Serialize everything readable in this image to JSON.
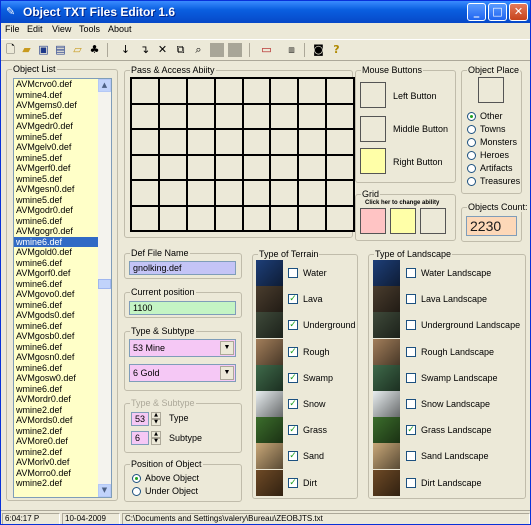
{
  "window": {
    "title": "Object TXT Files Editor 1.6"
  },
  "menu": [
    "File",
    "Edit",
    "View",
    "Tools",
    "About"
  ],
  "toolbar": {
    "icons": [
      "new-file-icon",
      "open-folder-icon",
      "save-icon",
      "save-all-icon",
      "open-file-icon",
      "tree-icon",
      "move-down-icon",
      "move-down-2-icon",
      "delete-icon",
      "copy-icon",
      "find-icon",
      "blank-1-icon",
      "blank-2-icon",
      "monitor-icon",
      "text-file-icon",
      "camera-icon",
      "help-icon"
    ]
  },
  "object_list": {
    "label": "Object List",
    "items": [
      "AVMcrvo0.def",
      "wmine4.def",
      "AVMgems0.def",
      "wmine5.def",
      "AVMgedr0.def",
      "wmine5.def",
      "AVMgelv0.def",
      "wmine5.def",
      "AVMgerf0.def",
      "wmine5.def",
      "AVMgesn0.def",
      "wmine5.def",
      "AVMgodr0.def",
      "wmine6.def",
      "AVMgogr0.def",
      "wmine6.def",
      "AVMgold0.def",
      "wmine6.def",
      "AVMgorf0.def",
      "wmine6.def",
      "AVMgovo0.def",
      "wmine6.def",
      "AVMgods0.def",
      "wmine6.def",
      "AVMgosb0.def",
      "wmine6.def",
      "AVMgosn0.def",
      "wmine6.def",
      "AVMgosw0.def",
      "wmine6.def",
      "AVMordr0.def",
      "wmine2.def",
      "AVMords0.def",
      "wmine2.def",
      "AVMore0.def",
      "wmine2.def",
      "AVMorlv0.def",
      "AVMorro0.def",
      "wmine2.def"
    ],
    "selected_index": 15
  },
  "pass_access": {
    "label": "Pass & Access Abiity",
    "rows": 6,
    "cols": 8
  },
  "mouse_buttons": {
    "label": "Mouse Buttons",
    "left": "Left Button",
    "middle": "Middle Button",
    "right": "Right Button"
  },
  "object_place": {
    "label": "Object Place",
    "options": [
      "Other",
      "Towns",
      "Monsters",
      "Heroes",
      "Artifacts",
      "Treasures"
    ],
    "selected": "Other"
  },
  "grid_group": {
    "label": "Grid",
    "hint": "Click her to change ability"
  },
  "objects_count": {
    "label": "Objects Count:",
    "value": "2230"
  },
  "def_file": {
    "label": "Def File Name",
    "value": "gnolking.def"
  },
  "current_position": {
    "label": "Current position",
    "value": "1100"
  },
  "type_subtype": {
    "label": "Type & Subtype",
    "type_value": "53  Mine",
    "subtype_value": "6  Gold"
  },
  "type_subtype2": {
    "label": "Type & Subtype",
    "type_num": "53",
    "type_label": "Type",
    "subtype_num": "6",
    "subtype_label": "Subtype"
  },
  "position_of_object": {
    "label": "Position of Object",
    "options": [
      "Above Object",
      "Under Object"
    ],
    "selected": "Above Object"
  },
  "terrain": {
    "label": "Type of Terrain",
    "items": [
      {
        "name": "Water",
        "checked": false,
        "color": "#1e3f78"
      },
      {
        "name": "Lava",
        "checked": true,
        "color": "#4a3d2e"
      },
      {
        "name": "Underground",
        "checked": true,
        "color": "#3f4a3a"
      },
      {
        "name": "Rough",
        "checked": true,
        "color": "#a27e5a"
      },
      {
        "name": "Swamp",
        "checked": true,
        "color": "#3f6a4a"
      },
      {
        "name": "Snow",
        "checked": true,
        "color": "#e8eef0"
      },
      {
        "name": "Grass",
        "checked": true,
        "color": "#3c6e2c"
      },
      {
        "name": "Sand",
        "checked": true,
        "color": "#c9a878"
      },
      {
        "name": "Dirt",
        "checked": true,
        "color": "#6e4a26"
      }
    ]
  },
  "landscape": {
    "label": "Type of Landscape",
    "items": [
      {
        "name": "Water Landscape",
        "checked": false,
        "color": "#1e3f78"
      },
      {
        "name": "Lava Landscape",
        "checked": false,
        "color": "#4a3d2e"
      },
      {
        "name": "Underground Landscape",
        "checked": false,
        "color": "#3f4a3a"
      },
      {
        "name": "Rough Landscape",
        "checked": false,
        "color": "#a27e5a"
      },
      {
        "name": "Swamp Landscape",
        "checked": false,
        "color": "#3f6a4a"
      },
      {
        "name": "Snow Landscape",
        "checked": false,
        "color": "#e8eef0"
      },
      {
        "name": "Grass Landscape",
        "checked": true,
        "color": "#3c6e2c"
      },
      {
        "name": "Sand Landscape",
        "checked": false,
        "color": "#c9a878"
      },
      {
        "name": "Dirt Landscape",
        "checked": false,
        "color": "#6e4a26"
      }
    ]
  },
  "statusbar": {
    "time": "6:04:17 P",
    "date": "10-04-2009",
    "path": "C:\\Documents and Settings\\valery\\Bureau\\ZEOBJTS.txt"
  }
}
